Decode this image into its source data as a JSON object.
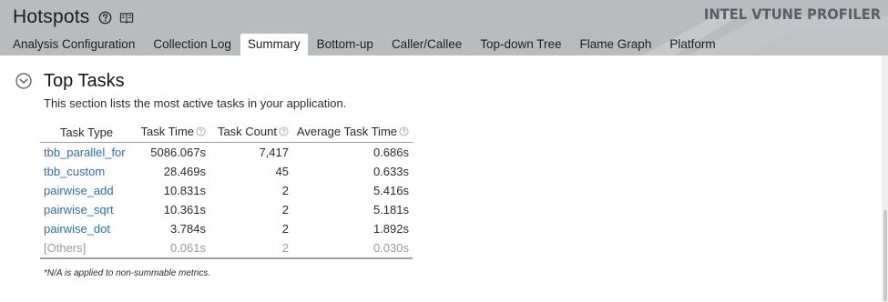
{
  "header": {
    "title": "Hotspots",
    "brand": "INTEL VTUNE PROFILER",
    "help_icon": "question-circle-icon",
    "docs_icon": "book-icon",
    "bg_color": "#b9bbbe"
  },
  "tabs": [
    {
      "label": "Analysis Configuration",
      "active": false
    },
    {
      "label": "Collection Log",
      "active": false
    },
    {
      "label": "Summary",
      "active": true
    },
    {
      "label": "Bottom-up",
      "active": false
    },
    {
      "label": "Caller/Callee",
      "active": false
    },
    {
      "label": "Top-down Tree",
      "active": false
    },
    {
      "label": "Flame Graph",
      "active": false
    },
    {
      "label": "Platform",
      "active": false
    }
  ],
  "section": {
    "title": "Top Tasks",
    "description": "This section lists the most active tasks in your application.",
    "toggle_icon": "chevron-down-circle-icon"
  },
  "table": {
    "columns": [
      "Task Type",
      "Task Time",
      "Task Count",
      "Average Task Time"
    ],
    "help_icon": "question-circle-icon",
    "rows": [
      {
        "type": "tbb_parallel_for",
        "time": "5086.067s",
        "count": "7,417",
        "avg": "0.686s"
      },
      {
        "type": "tbb_custom",
        "time": "28.469s",
        "count": "45",
        "avg": "0.633s"
      },
      {
        "type": "pairwise_add",
        "time": "10.831s",
        "count": "2",
        "avg": "5.416s"
      },
      {
        "type": "pairwise_sqrt",
        "time": "10.361s",
        "count": "2",
        "avg": "5.181s"
      },
      {
        "type": "pairwise_dot",
        "time": "3.784s",
        "count": "2",
        "avg": "1.892s"
      },
      {
        "type": "[Others]",
        "time": "0.061s",
        "count": "2",
        "avg": "0.030s"
      }
    ],
    "link_color": "#2a6ebb"
  },
  "footnote": "*N/A is applied to non-summable metrics."
}
